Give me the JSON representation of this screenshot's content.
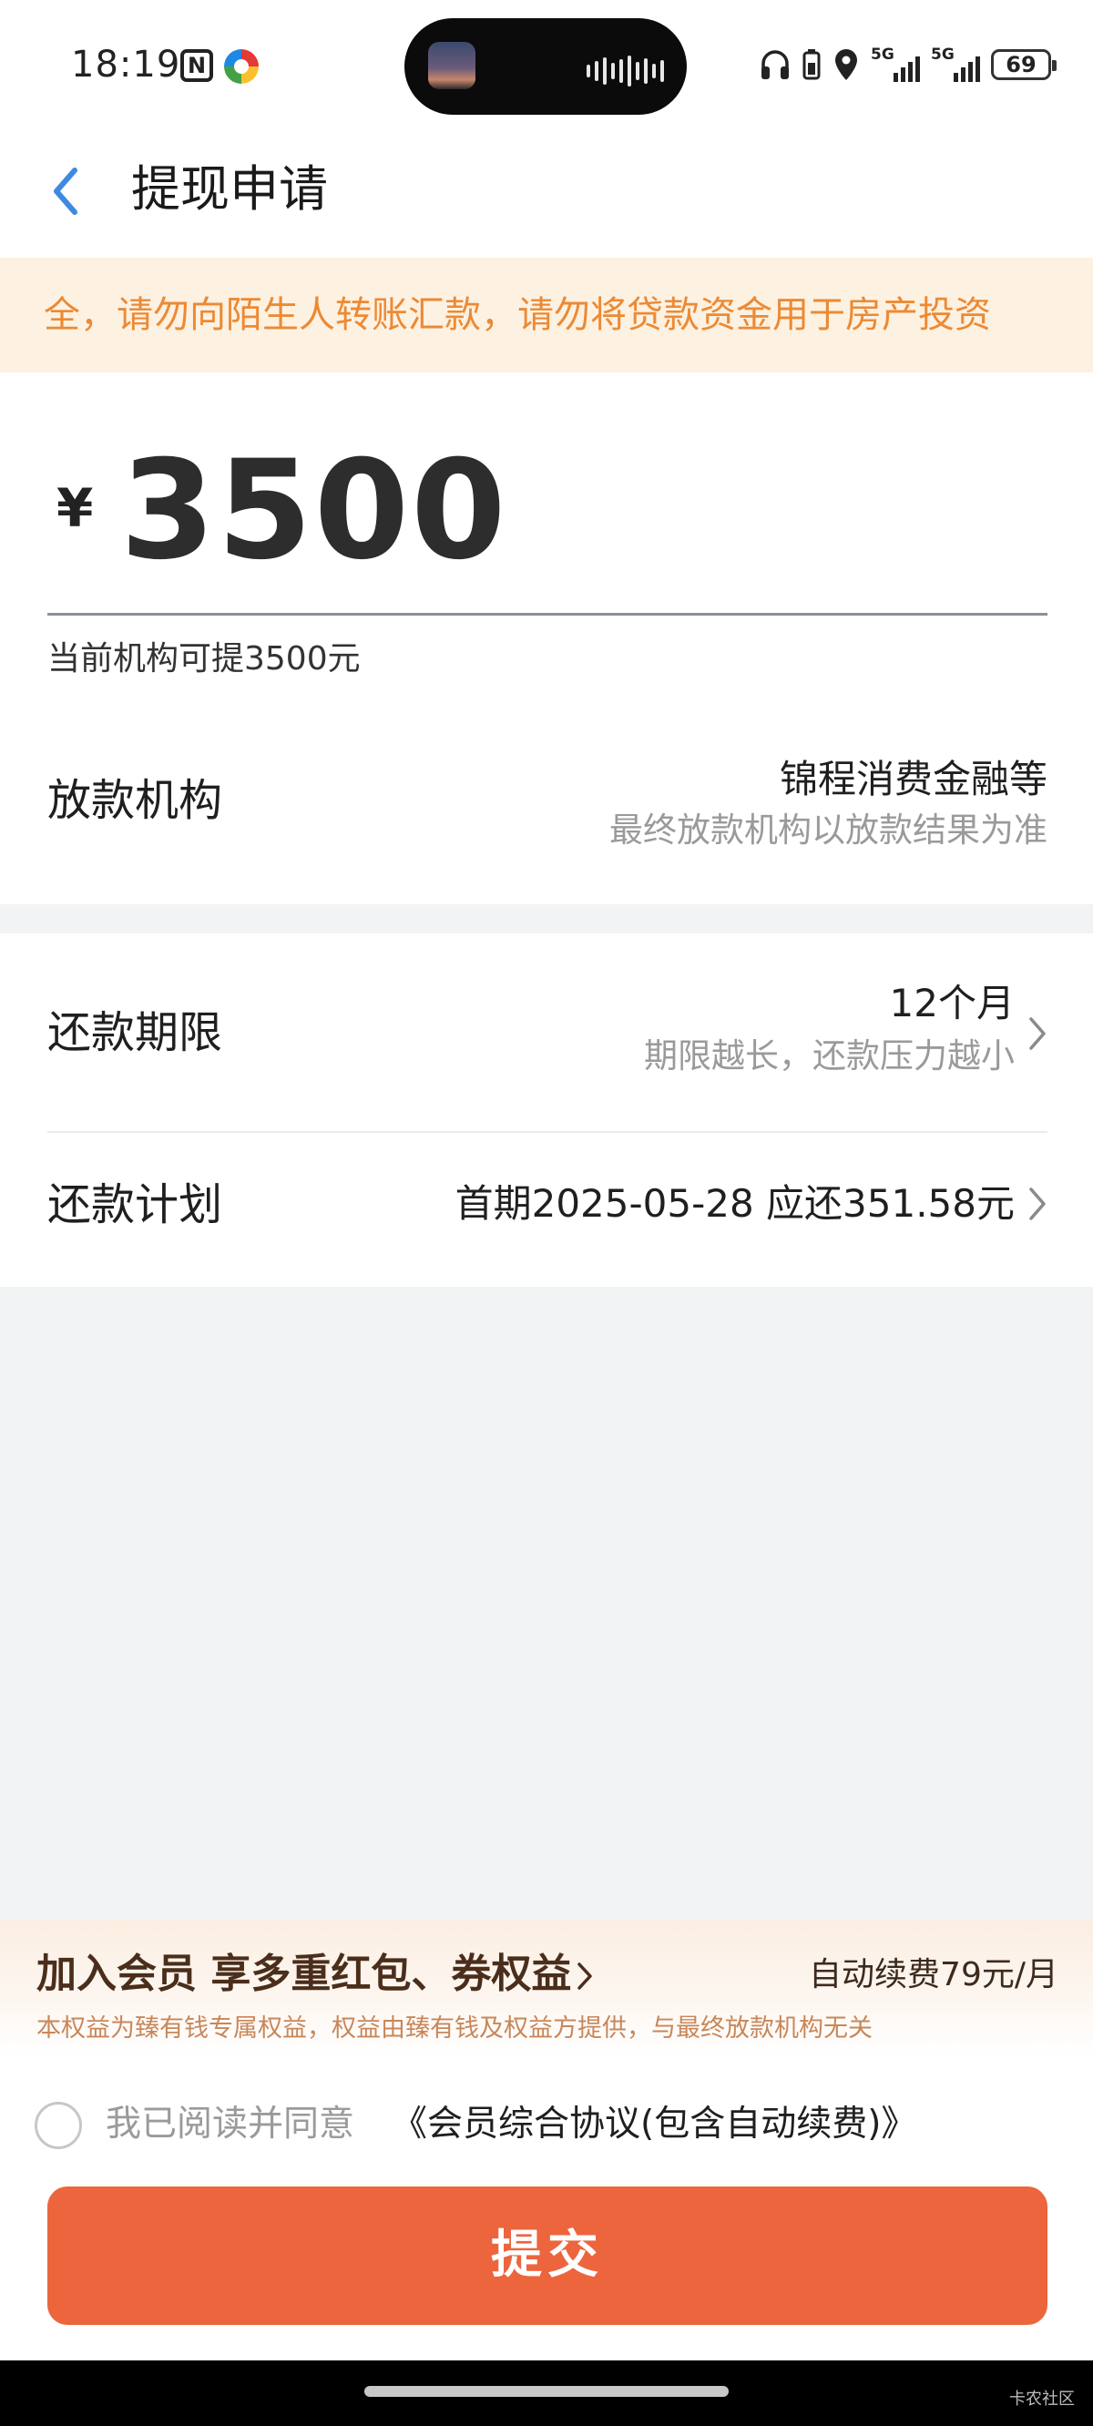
{
  "status_bar": {
    "time": "18:19",
    "nfc": "N",
    "signal1": "5G",
    "signal2": "5G",
    "battery": "69"
  },
  "header": {
    "title": "提现申请"
  },
  "notice": {
    "text": "全，请勿向陌生人转账汇款，请勿将贷款资金用于房产投资"
  },
  "amount": {
    "currency": "¥",
    "value": "3500",
    "available_text": "当前机构可提3500元"
  },
  "lender": {
    "label": "放款机构",
    "value": "锦程消费金融等",
    "note": "最终放款机构以放款结果为准"
  },
  "term": {
    "label": "还款期限",
    "value": "12个月",
    "note": "期限越长，还款压力越小"
  },
  "plan": {
    "label": "还款计划",
    "value": "首期2025-05-28 应还351.58元"
  },
  "membership": {
    "title": "加入会员 享多重红包、券权益",
    "fee": "自动续费79元/月",
    "note": "本权益为臻有钱专属权益，权益由臻有钱及权益方提供，与最终放款机构无关"
  },
  "agreement": {
    "prefix": "我已阅读并同意",
    "link": "《会员综合协议(包含自动续费)》"
  },
  "submit": {
    "label": "提交"
  },
  "watermark": "卡农社区"
}
